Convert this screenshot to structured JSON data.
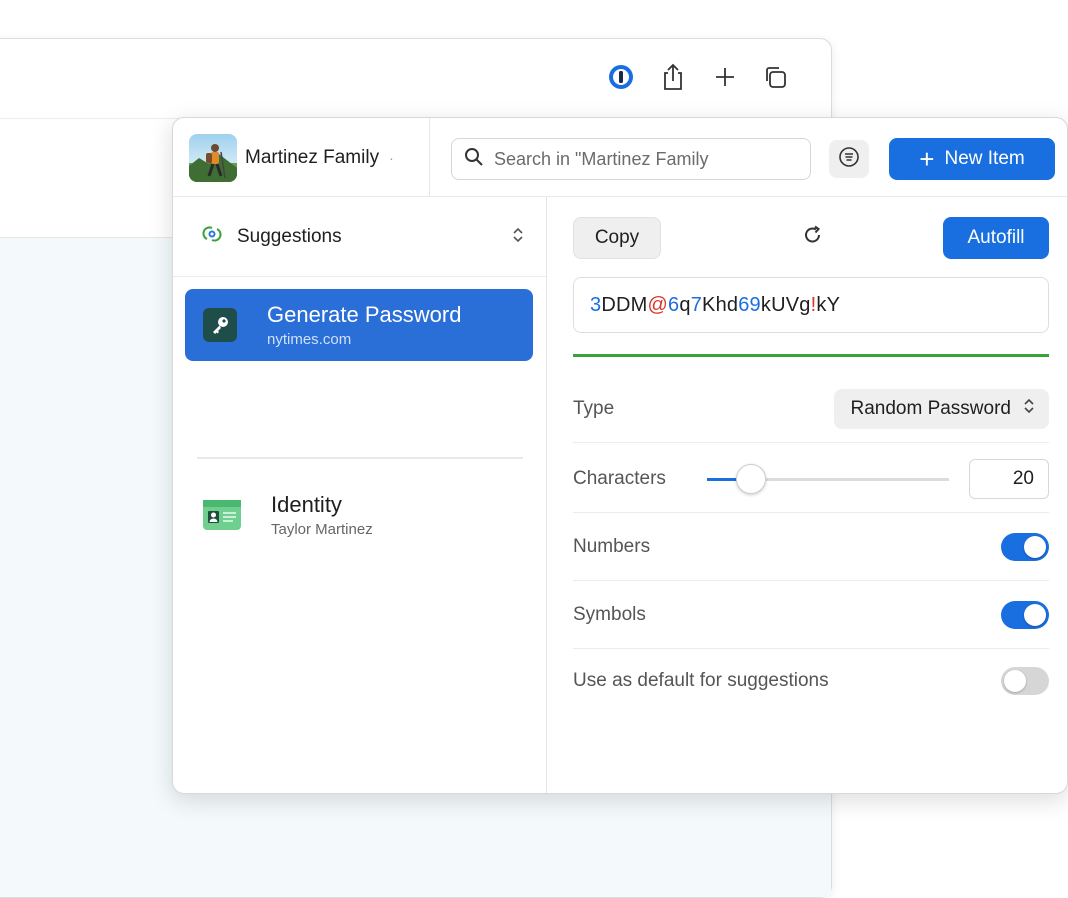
{
  "browser": {
    "toolbar_icons": [
      "1password-icon",
      "share-icon",
      "new-tab-icon",
      "tabs-overview-icon"
    ]
  },
  "header": {
    "vault_name": "Martinez Family",
    "search_placeholder": "Search in \"Martinez Family",
    "new_item_label": "New Item"
  },
  "sidebar": {
    "filter_label": "Suggestions",
    "items": [
      {
        "title": "Generate Password",
        "subtitle": "nytimes.com",
        "selected": true,
        "icon": "key-icon"
      },
      {
        "title": "Identity",
        "subtitle": "Taylor Martinez",
        "selected": false,
        "icon": "identity-card-icon"
      }
    ]
  },
  "generator": {
    "copy_label": "Copy",
    "autofill_label": "Autofill",
    "password": "3DDM@6q7Khd69kUVg!kY",
    "type_label": "Type",
    "type_value": "Random Password",
    "characters_label": "Characters",
    "characters_value": "20",
    "characters_slider_fraction": 0.18,
    "numbers_label": "Numbers",
    "numbers_on": true,
    "symbols_label": "Symbols",
    "symbols_on": true,
    "default_label": "Use as default for suggestions",
    "default_on": false
  },
  "colors": {
    "accent": "#1a6fe0",
    "selected_row": "#2a6ed8",
    "strength": "#3aa23a",
    "password_digit": "#1a6fe0",
    "password_symbol": "#d9382b"
  }
}
